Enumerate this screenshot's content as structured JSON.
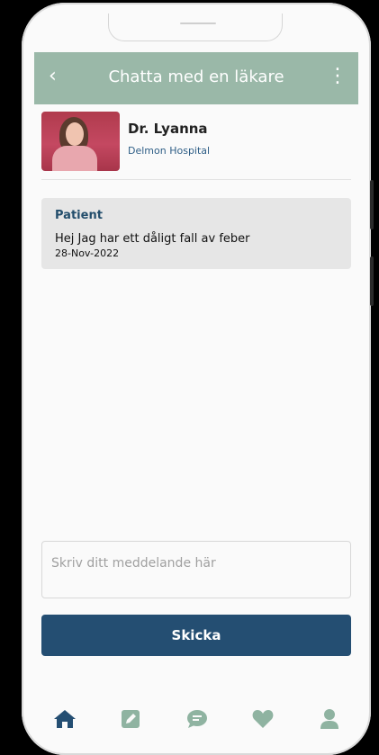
{
  "header": {
    "back_icon": "chevron-left-icon",
    "title": "Chatta med en läkare",
    "menu_icon": "more-vertical-icon"
  },
  "doctor": {
    "name": "Dr. Lyanna",
    "hospital": "Delmon Hospital"
  },
  "messages": [
    {
      "sender": "Patient",
      "text": "Hej Jag har ett dåligt fall av feber",
      "date": "28-Nov-2022"
    }
  ],
  "composer": {
    "placeholder": "Skriv ditt meddelande här",
    "value": ""
  },
  "send_button": {
    "label": "Skicka"
  },
  "bottom_nav": {
    "items": [
      {
        "icon": "home-icon",
        "active": true
      },
      {
        "icon": "edit-icon",
        "active": false
      },
      {
        "icon": "chat-icon",
        "active": false
      },
      {
        "icon": "heart-icon",
        "active": false
      },
      {
        "icon": "user-icon",
        "active": false
      }
    ]
  },
  "colors": {
    "header_bg": "#9ab8a8",
    "primary": "#244e72",
    "nav_active": "#244e72",
    "nav_inactive": "#8fb3a1"
  }
}
